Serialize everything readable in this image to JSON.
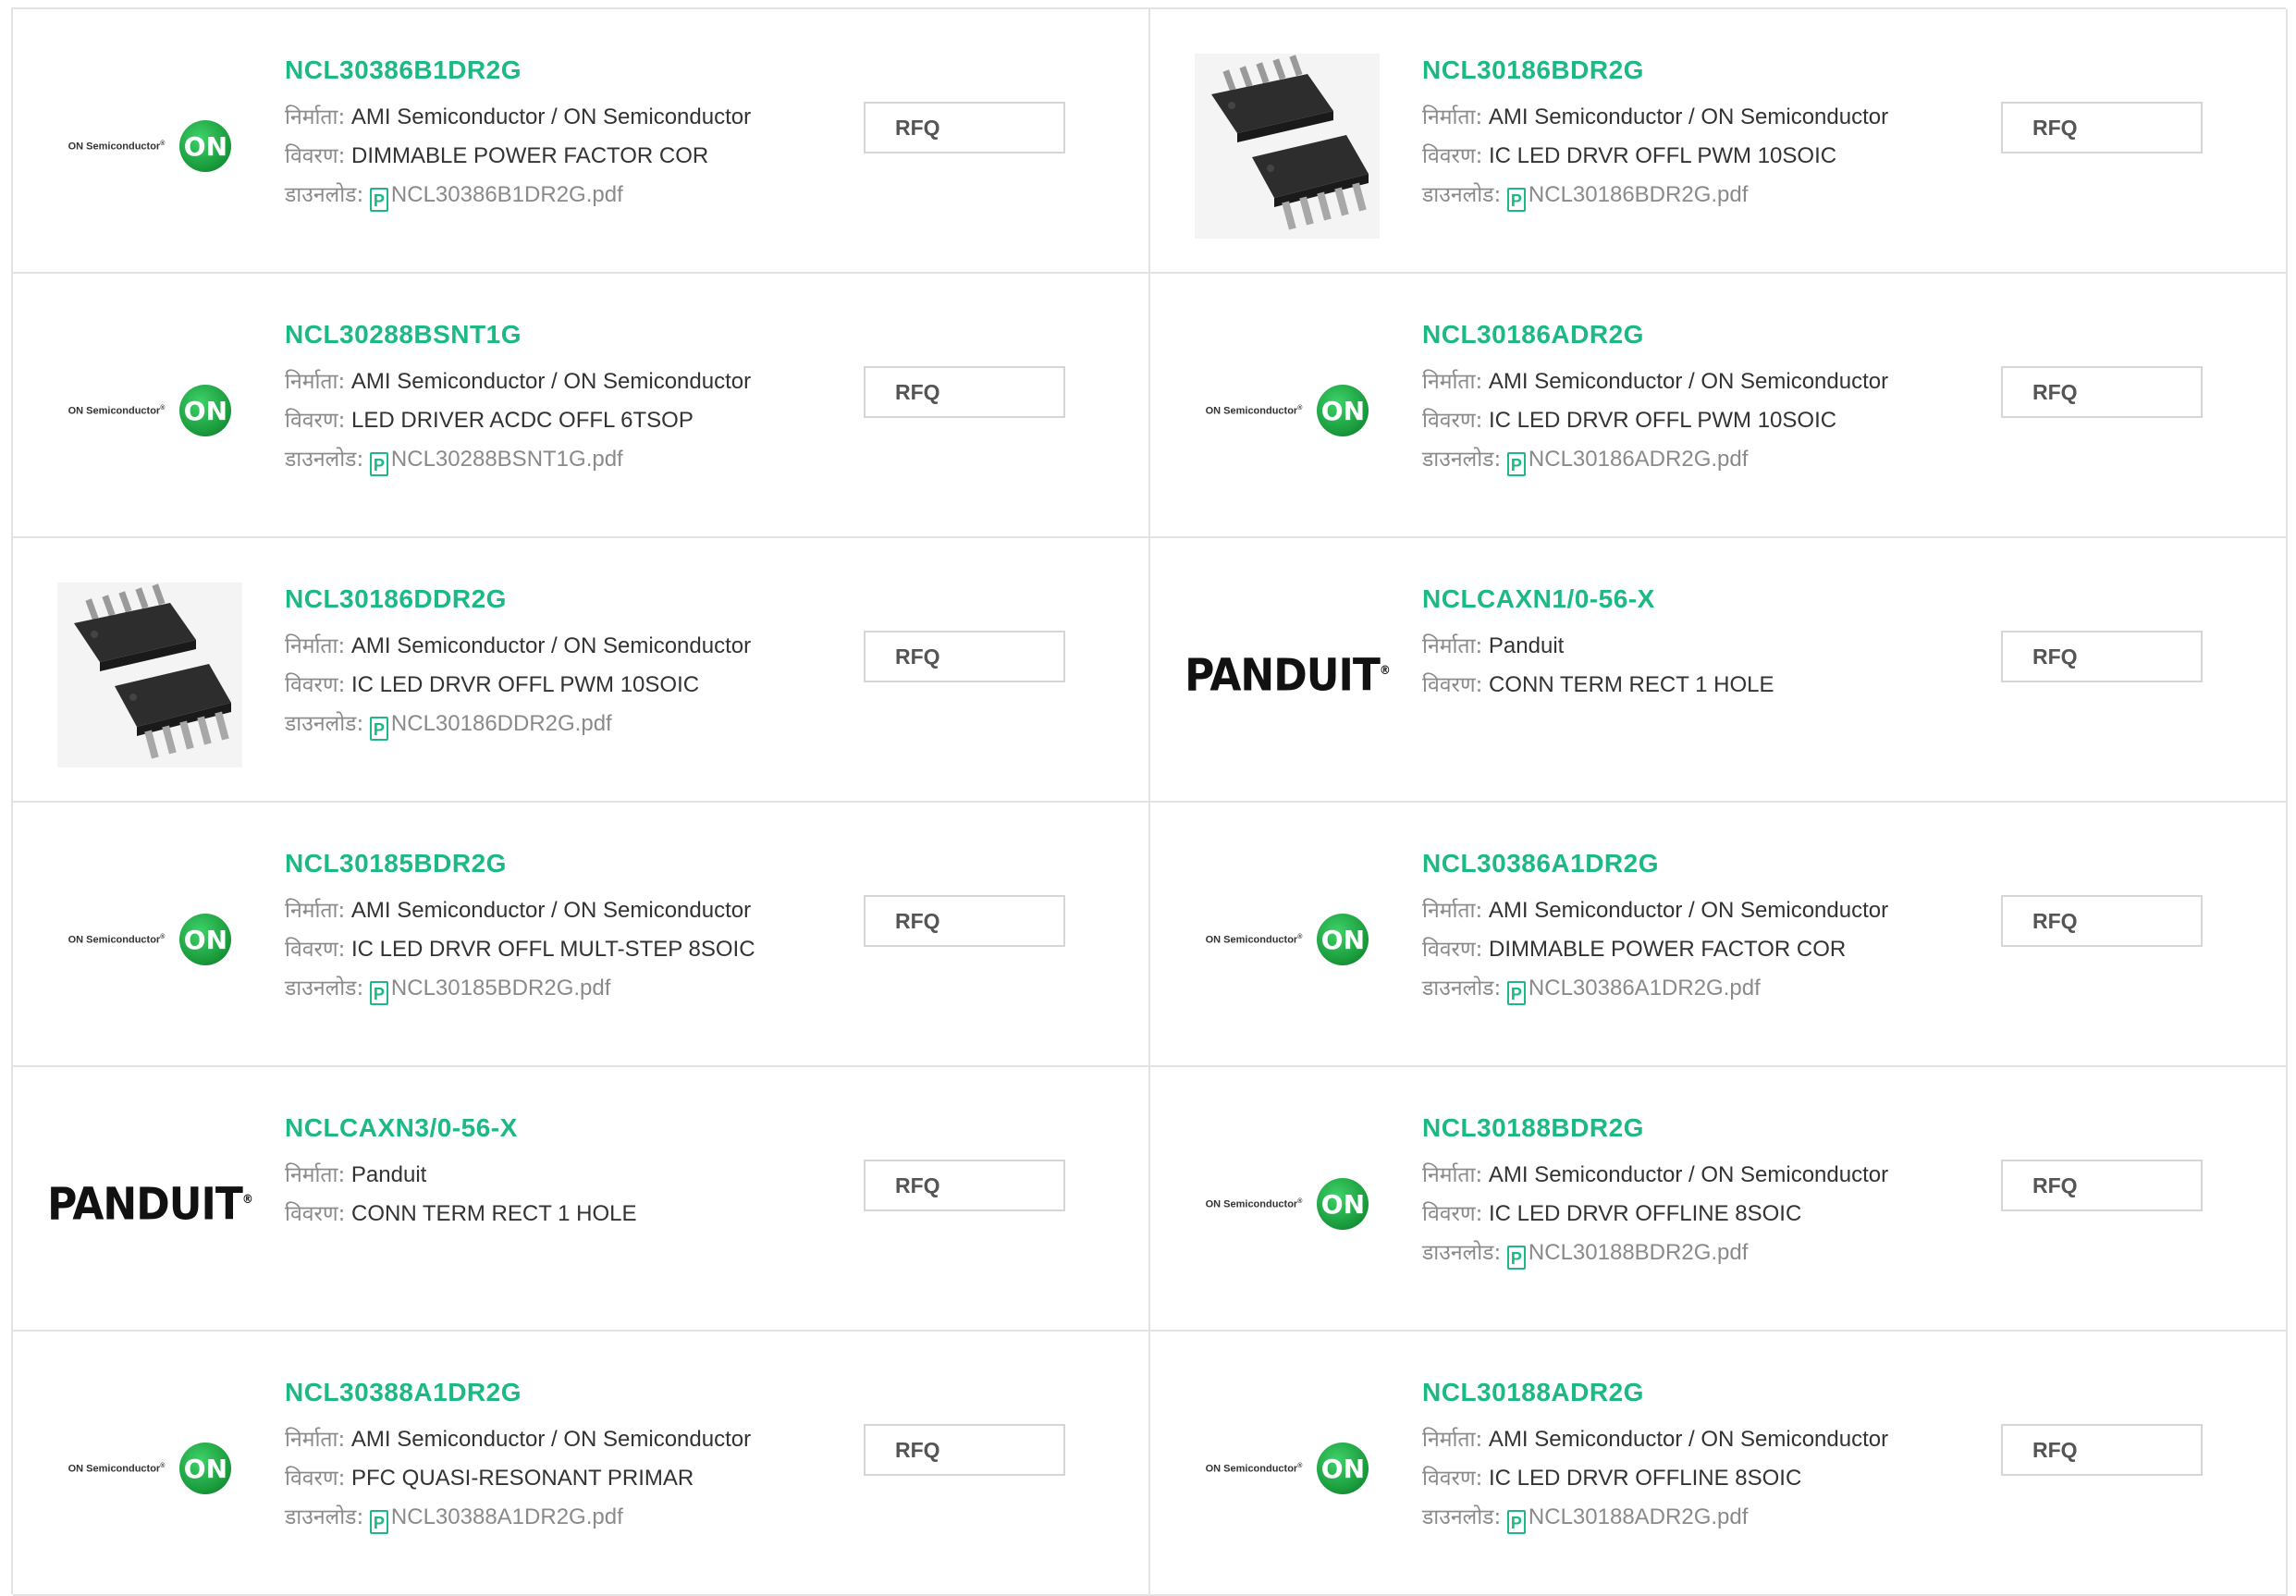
{
  "labels": {
    "manufacturer": "निर्माता:",
    "description": "विवरण:",
    "download": "डाउनलोड:",
    "rfq": "RFQ",
    "pdf_glyph": "P"
  },
  "logos": {
    "on_semi_text": "ON Semiconductor",
    "on_semi_mark": "ON",
    "panduit": "PANDUIT"
  },
  "colors": {
    "part_link": "#1cb886",
    "on_green": "#1a9b3c",
    "border": "#e3e3e3"
  },
  "products": [
    {
      "part": "NCL30386B1DR2G",
      "image": "on-semiconductor-logo",
      "manufacturer": "AMI Semiconductor / ON Semiconductor",
      "description": "DIMMABLE POWER FACTOR COR",
      "file": "NCL30386B1DR2G.pdf"
    },
    {
      "part": "NCL30186BDR2G",
      "image": "ic-chip-photo",
      "manufacturer": "AMI Semiconductor / ON Semiconductor",
      "description": "IC LED DRVR OFFL PWM 10SOIC",
      "file": "NCL30186BDR2G.pdf"
    },
    {
      "part": "NCL30288BSNT1G",
      "image": "on-semiconductor-logo",
      "manufacturer": "AMI Semiconductor / ON Semiconductor",
      "description": "LED DRIVER ACDC OFFL 6TSOP",
      "file": "NCL30288BSNT1G.pdf"
    },
    {
      "part": "NCL30186ADR2G",
      "image": "on-semiconductor-logo",
      "manufacturer": "AMI Semiconductor / ON Semiconductor",
      "description": "IC LED DRVR OFFL PWM 10SOIC",
      "file": "NCL30186ADR2G.pdf"
    },
    {
      "part": "NCL30186DDR2G",
      "image": "ic-chip-photo",
      "manufacturer": "AMI Semiconductor / ON Semiconductor",
      "description": "IC LED DRVR OFFL PWM 10SOIC",
      "file": "NCL30186DDR2G.pdf"
    },
    {
      "part": "NCLCAXN1/0-56-X",
      "image": "panduit-logo",
      "manufacturer": "Panduit",
      "description": "CONN TERM RECT 1 HOLE",
      "file": null
    },
    {
      "part": "NCL30185BDR2G",
      "image": "on-semiconductor-logo",
      "manufacturer": "AMI Semiconductor / ON Semiconductor",
      "description": "IC LED DRVR OFFL MULT-STEP 8SOIC",
      "file": "NCL30185BDR2G.pdf"
    },
    {
      "part": "NCL30386A1DR2G",
      "image": "on-semiconductor-logo",
      "manufacturer": "AMI Semiconductor / ON Semiconductor",
      "description": "DIMMABLE POWER FACTOR COR",
      "file": "NCL30386A1DR2G.pdf"
    },
    {
      "part": "NCLCAXN3/0-56-X",
      "image": "panduit-logo",
      "manufacturer": "Panduit",
      "description": "CONN TERM RECT 1 HOLE",
      "file": null
    },
    {
      "part": "NCL30188BDR2G",
      "image": "on-semiconductor-logo",
      "manufacturer": "AMI Semiconductor / ON Semiconductor",
      "description": "IC LED DRVR OFFLINE 8SOIC",
      "file": "NCL30188BDR2G.pdf"
    },
    {
      "part": "NCL30388A1DR2G",
      "image": "on-semiconductor-logo",
      "manufacturer": "AMI Semiconductor / ON Semiconductor",
      "description": "PFC QUASI-RESONANT PRIMAR",
      "file": "NCL30388A1DR2G.pdf"
    },
    {
      "part": "NCL30188ADR2G",
      "image": "on-semiconductor-logo",
      "manufacturer": "AMI Semiconductor / ON Semiconductor",
      "description": "IC LED DRVR OFFLINE 8SOIC",
      "file": "NCL30188ADR2G.pdf"
    }
  ]
}
